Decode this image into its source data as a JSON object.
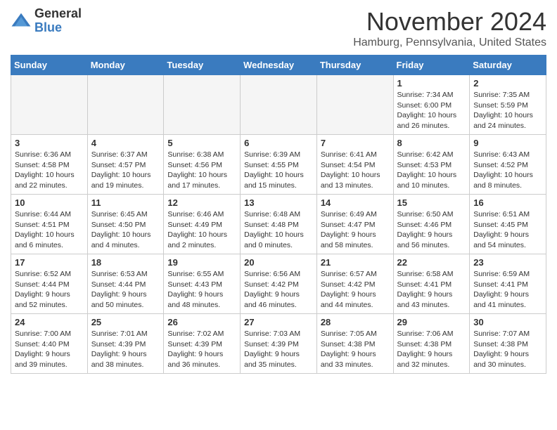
{
  "logo": {
    "general": "General",
    "blue": "Blue"
  },
  "header": {
    "month": "November 2024",
    "location": "Hamburg, Pennsylvania, United States"
  },
  "weekdays": [
    "Sunday",
    "Monday",
    "Tuesday",
    "Wednesday",
    "Thursday",
    "Friday",
    "Saturday"
  ],
  "weeks": [
    [
      {
        "day": "",
        "empty": true
      },
      {
        "day": "",
        "empty": true
      },
      {
        "day": "",
        "empty": true
      },
      {
        "day": "",
        "empty": true
      },
      {
        "day": "",
        "empty": true
      },
      {
        "day": "1",
        "sunrise": "Sunrise: 7:34 AM",
        "sunset": "Sunset: 6:00 PM",
        "daylight": "Daylight: 10 hours and 26 minutes."
      },
      {
        "day": "2",
        "sunrise": "Sunrise: 7:35 AM",
        "sunset": "Sunset: 5:59 PM",
        "daylight": "Daylight: 10 hours and 24 minutes."
      }
    ],
    [
      {
        "day": "3",
        "sunrise": "Sunrise: 6:36 AM",
        "sunset": "Sunset: 4:58 PM",
        "daylight": "Daylight: 10 hours and 22 minutes."
      },
      {
        "day": "4",
        "sunrise": "Sunrise: 6:37 AM",
        "sunset": "Sunset: 4:57 PM",
        "daylight": "Daylight: 10 hours and 19 minutes."
      },
      {
        "day": "5",
        "sunrise": "Sunrise: 6:38 AM",
        "sunset": "Sunset: 4:56 PM",
        "daylight": "Daylight: 10 hours and 17 minutes."
      },
      {
        "day": "6",
        "sunrise": "Sunrise: 6:39 AM",
        "sunset": "Sunset: 4:55 PM",
        "daylight": "Daylight: 10 hours and 15 minutes."
      },
      {
        "day": "7",
        "sunrise": "Sunrise: 6:41 AM",
        "sunset": "Sunset: 4:54 PM",
        "daylight": "Daylight: 10 hours and 13 minutes."
      },
      {
        "day": "8",
        "sunrise": "Sunrise: 6:42 AM",
        "sunset": "Sunset: 4:53 PM",
        "daylight": "Daylight: 10 hours and 10 minutes."
      },
      {
        "day": "9",
        "sunrise": "Sunrise: 6:43 AM",
        "sunset": "Sunset: 4:52 PM",
        "daylight": "Daylight: 10 hours and 8 minutes."
      }
    ],
    [
      {
        "day": "10",
        "sunrise": "Sunrise: 6:44 AM",
        "sunset": "Sunset: 4:51 PM",
        "daylight": "Daylight: 10 hours and 6 minutes."
      },
      {
        "day": "11",
        "sunrise": "Sunrise: 6:45 AM",
        "sunset": "Sunset: 4:50 PM",
        "daylight": "Daylight: 10 hours and 4 minutes."
      },
      {
        "day": "12",
        "sunrise": "Sunrise: 6:46 AM",
        "sunset": "Sunset: 4:49 PM",
        "daylight": "Daylight: 10 hours and 2 minutes."
      },
      {
        "day": "13",
        "sunrise": "Sunrise: 6:48 AM",
        "sunset": "Sunset: 4:48 PM",
        "daylight": "Daylight: 10 hours and 0 minutes."
      },
      {
        "day": "14",
        "sunrise": "Sunrise: 6:49 AM",
        "sunset": "Sunset: 4:47 PM",
        "daylight": "Daylight: 9 hours and 58 minutes."
      },
      {
        "day": "15",
        "sunrise": "Sunrise: 6:50 AM",
        "sunset": "Sunset: 4:46 PM",
        "daylight": "Daylight: 9 hours and 56 minutes."
      },
      {
        "day": "16",
        "sunrise": "Sunrise: 6:51 AM",
        "sunset": "Sunset: 4:45 PM",
        "daylight": "Daylight: 9 hours and 54 minutes."
      }
    ],
    [
      {
        "day": "17",
        "sunrise": "Sunrise: 6:52 AM",
        "sunset": "Sunset: 4:44 PM",
        "daylight": "Daylight: 9 hours and 52 minutes."
      },
      {
        "day": "18",
        "sunrise": "Sunrise: 6:53 AM",
        "sunset": "Sunset: 4:44 PM",
        "daylight": "Daylight: 9 hours and 50 minutes."
      },
      {
        "day": "19",
        "sunrise": "Sunrise: 6:55 AM",
        "sunset": "Sunset: 4:43 PM",
        "daylight": "Daylight: 9 hours and 48 minutes."
      },
      {
        "day": "20",
        "sunrise": "Sunrise: 6:56 AM",
        "sunset": "Sunset: 4:42 PM",
        "daylight": "Daylight: 9 hours and 46 minutes."
      },
      {
        "day": "21",
        "sunrise": "Sunrise: 6:57 AM",
        "sunset": "Sunset: 4:42 PM",
        "daylight": "Daylight: 9 hours and 44 minutes."
      },
      {
        "day": "22",
        "sunrise": "Sunrise: 6:58 AM",
        "sunset": "Sunset: 4:41 PM",
        "daylight": "Daylight: 9 hours and 43 minutes."
      },
      {
        "day": "23",
        "sunrise": "Sunrise: 6:59 AM",
        "sunset": "Sunset: 4:41 PM",
        "daylight": "Daylight: 9 hours and 41 minutes."
      }
    ],
    [
      {
        "day": "24",
        "sunrise": "Sunrise: 7:00 AM",
        "sunset": "Sunset: 4:40 PM",
        "daylight": "Daylight: 9 hours and 39 minutes."
      },
      {
        "day": "25",
        "sunrise": "Sunrise: 7:01 AM",
        "sunset": "Sunset: 4:39 PM",
        "daylight": "Daylight: 9 hours and 38 minutes."
      },
      {
        "day": "26",
        "sunrise": "Sunrise: 7:02 AM",
        "sunset": "Sunset: 4:39 PM",
        "daylight": "Daylight: 9 hours and 36 minutes."
      },
      {
        "day": "27",
        "sunrise": "Sunrise: 7:03 AM",
        "sunset": "Sunset: 4:39 PM",
        "daylight": "Daylight: 9 hours and 35 minutes."
      },
      {
        "day": "28",
        "sunrise": "Sunrise: 7:05 AM",
        "sunset": "Sunset: 4:38 PM",
        "daylight": "Daylight: 9 hours and 33 minutes."
      },
      {
        "day": "29",
        "sunrise": "Sunrise: 7:06 AM",
        "sunset": "Sunset: 4:38 PM",
        "daylight": "Daylight: 9 hours and 32 minutes."
      },
      {
        "day": "30",
        "sunrise": "Sunrise: 7:07 AM",
        "sunset": "Sunset: 4:38 PM",
        "daylight": "Daylight: 9 hours and 30 minutes."
      }
    ]
  ]
}
